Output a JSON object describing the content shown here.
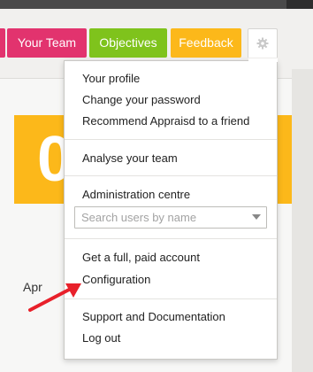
{
  "nav": {
    "team_label": "Your Team",
    "objectives_label": "Objectives",
    "feedback_label": "Feedback",
    "settings_icon": "gear-icon"
  },
  "background": {
    "card_digit": "0",
    "month_label": "Apr"
  },
  "menu": {
    "profile": "Your profile",
    "change_password": "Change your password",
    "recommend": "Recommend Appraisd to a friend",
    "analyse": "Analyse your team",
    "admin": "Administration centre",
    "search_placeholder": "Search users by name",
    "paid_account": "Get a full, paid account",
    "configuration": "Configuration",
    "support": "Support and Documentation",
    "logout": "Log out"
  },
  "colors": {
    "team": "#e2336e",
    "objectives": "#7fc31c",
    "feedback": "#fcb81a",
    "annotation_arrow": "#e8202a"
  }
}
